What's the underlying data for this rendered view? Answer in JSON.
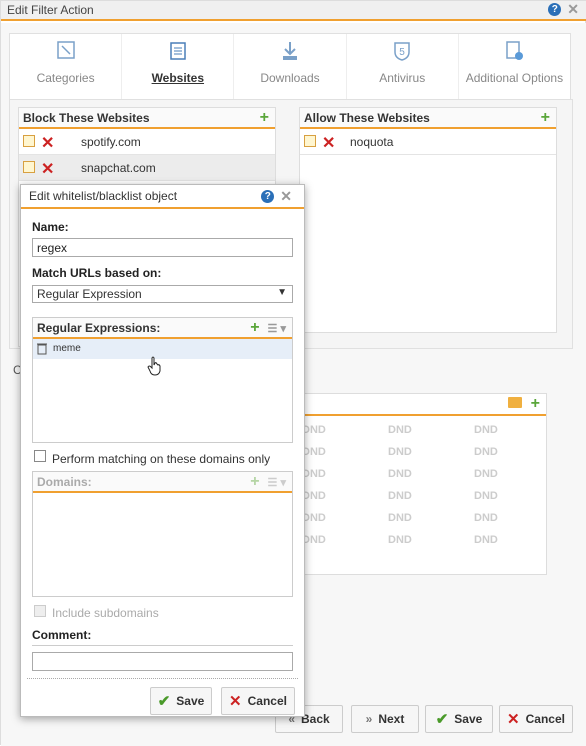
{
  "window": {
    "title": "Edit Filter Action"
  },
  "tabs": [
    {
      "label": "Categories",
      "icon": "categories-icon"
    },
    {
      "label": "Websites",
      "icon": "websites-icon",
      "active": true
    },
    {
      "label": "Downloads",
      "icon": "downloads-icon"
    },
    {
      "label": "Antivirus",
      "icon": "antivirus-icon"
    },
    {
      "label": "Additional Options",
      "icon": "additional-options-icon"
    }
  ],
  "block": {
    "title": "Block These Websites",
    "items": [
      "spotify.com",
      "snapchat.com"
    ]
  },
  "allow": {
    "title": "Allow These Websites",
    "items": [
      "noquota"
    ]
  },
  "dnd": {
    "cells": [
      "DND",
      "DND",
      "DND",
      "DND",
      "DND",
      "DND",
      "DND",
      "DND",
      "DND",
      "DND",
      "DND",
      "DND",
      "DND",
      "DND",
      "DND",
      "DND",
      "DND",
      "DND"
    ]
  },
  "hidden_label": "C",
  "bottom": {
    "back": "Back",
    "next": "Next",
    "save": "Save",
    "cancel": "Cancel"
  },
  "dialog": {
    "title": "Edit whitelist/blacklist object",
    "name_label": "Name:",
    "name_value": "regex",
    "match_label": "Match URLs based on:",
    "match_value": "Regular Expression",
    "regex_title": "Regular Expressions:",
    "regex_items": [
      "meme"
    ],
    "domains_only_label": "Perform matching on these domains only",
    "domains_title": "Domains:",
    "include_sub_label": "Include subdomains",
    "comment_label": "Comment:",
    "comment_value": "",
    "save": "Save",
    "cancel": "Cancel"
  }
}
